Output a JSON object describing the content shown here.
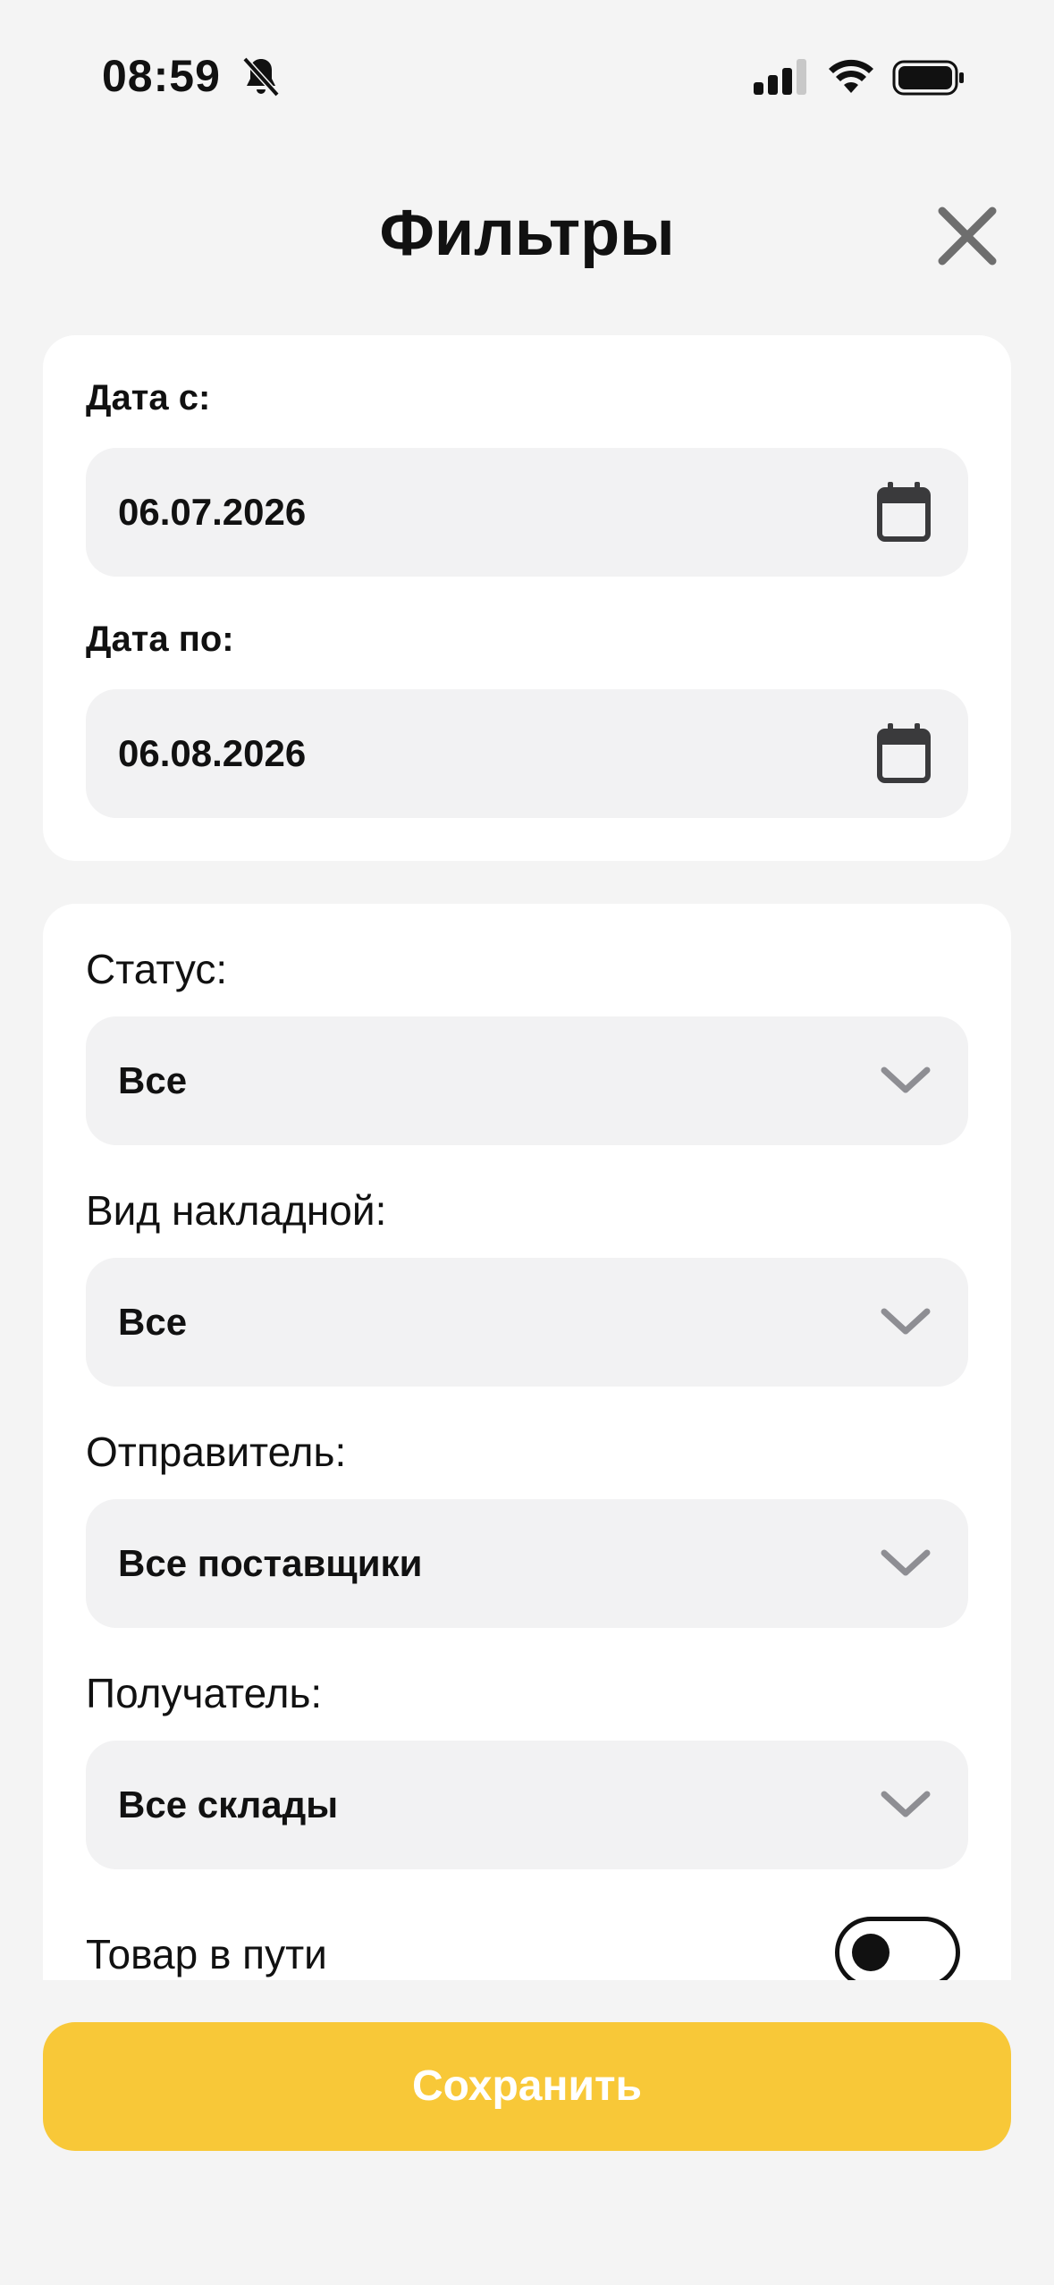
{
  "status_bar": {
    "time": "08:59"
  },
  "header": {
    "title": "Фильтры"
  },
  "dates": {
    "from_label": "Дата с:",
    "from_value": "06.07.2026",
    "to_label": "Дата по:",
    "to_value": "06.08.2026"
  },
  "filters": {
    "status_label": "Статус:",
    "status_value": "Все",
    "invoice_type_label": "Вид накладной:",
    "invoice_type_value": "Все",
    "sender_label": "Отправитель:",
    "sender_value": "Все поставщики",
    "recipient_label": "Получатель:",
    "recipient_value": "Все склады",
    "in_transit_label": "Товар в пути",
    "in_transit_on": false
  },
  "actions": {
    "save_label": "Сохранить"
  },
  "colors": {
    "accent": "#f8c838",
    "field_bg": "#f2f2f3",
    "page_bg": "#f4f4f4"
  },
  "icons": [
    "bell-off-icon",
    "signal-icon",
    "wifi-icon",
    "battery-icon",
    "close-icon",
    "calendar-icon",
    "chevron-down-icon"
  ]
}
